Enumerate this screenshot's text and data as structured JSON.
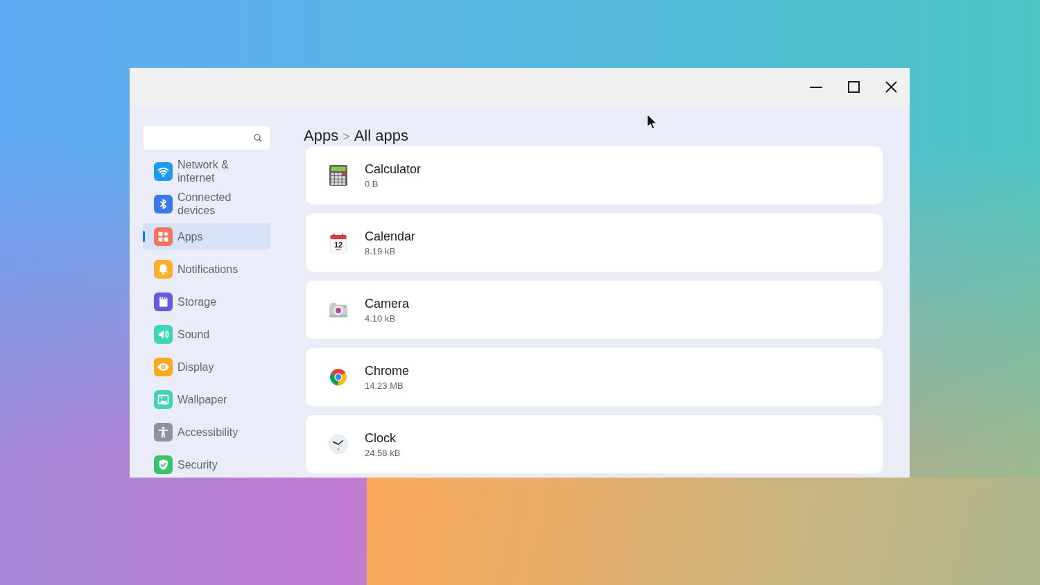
{
  "sidebar": {
    "items": [
      {
        "label": "Network & internet",
        "kind": "wifi",
        "color": "#1e9af2",
        "selected": false
      },
      {
        "label": "Connected devices",
        "kind": "bluetooth",
        "color": "#3b78ee",
        "selected": false
      },
      {
        "label": "Apps",
        "kind": "apps",
        "color": "#f7735a",
        "selected": true
      },
      {
        "label": "Notifications",
        "kind": "bell",
        "color": "#fbb12e",
        "selected": false
      },
      {
        "label": "Storage",
        "kind": "storage",
        "color": "#6a58e0",
        "selected": false
      },
      {
        "label": "Sound",
        "kind": "sound",
        "color": "#3ed6b8",
        "selected": false
      },
      {
        "label": "Display",
        "kind": "display",
        "color": "#fba81c",
        "selected": false
      },
      {
        "label": "Wallpaper",
        "kind": "wallpaper",
        "color": "#40d4b6",
        "selected": false
      },
      {
        "label": "Accessibility",
        "kind": "accessibility",
        "color": "#8a92a4",
        "selected": false
      },
      {
        "label": "Security",
        "kind": "security",
        "color": "#37c46c",
        "selected": false
      }
    ]
  },
  "main": {
    "breadcrumb": {
      "parent": "Apps",
      "separator": ">",
      "current": "All apps"
    },
    "apps": [
      {
        "name": "Calculator",
        "size": "0 B",
        "kind": "calculator"
      },
      {
        "name": "Calendar",
        "size": "8.19 kB",
        "kind": "calendar",
        "icon_text": "12"
      },
      {
        "name": "Camera",
        "size": "4.10 kB",
        "kind": "camera"
      },
      {
        "name": "Chrome",
        "size": "14.23 MB",
        "kind": "chrome"
      },
      {
        "name": "Clock",
        "size": "24.58 kB",
        "kind": "clock"
      }
    ]
  }
}
